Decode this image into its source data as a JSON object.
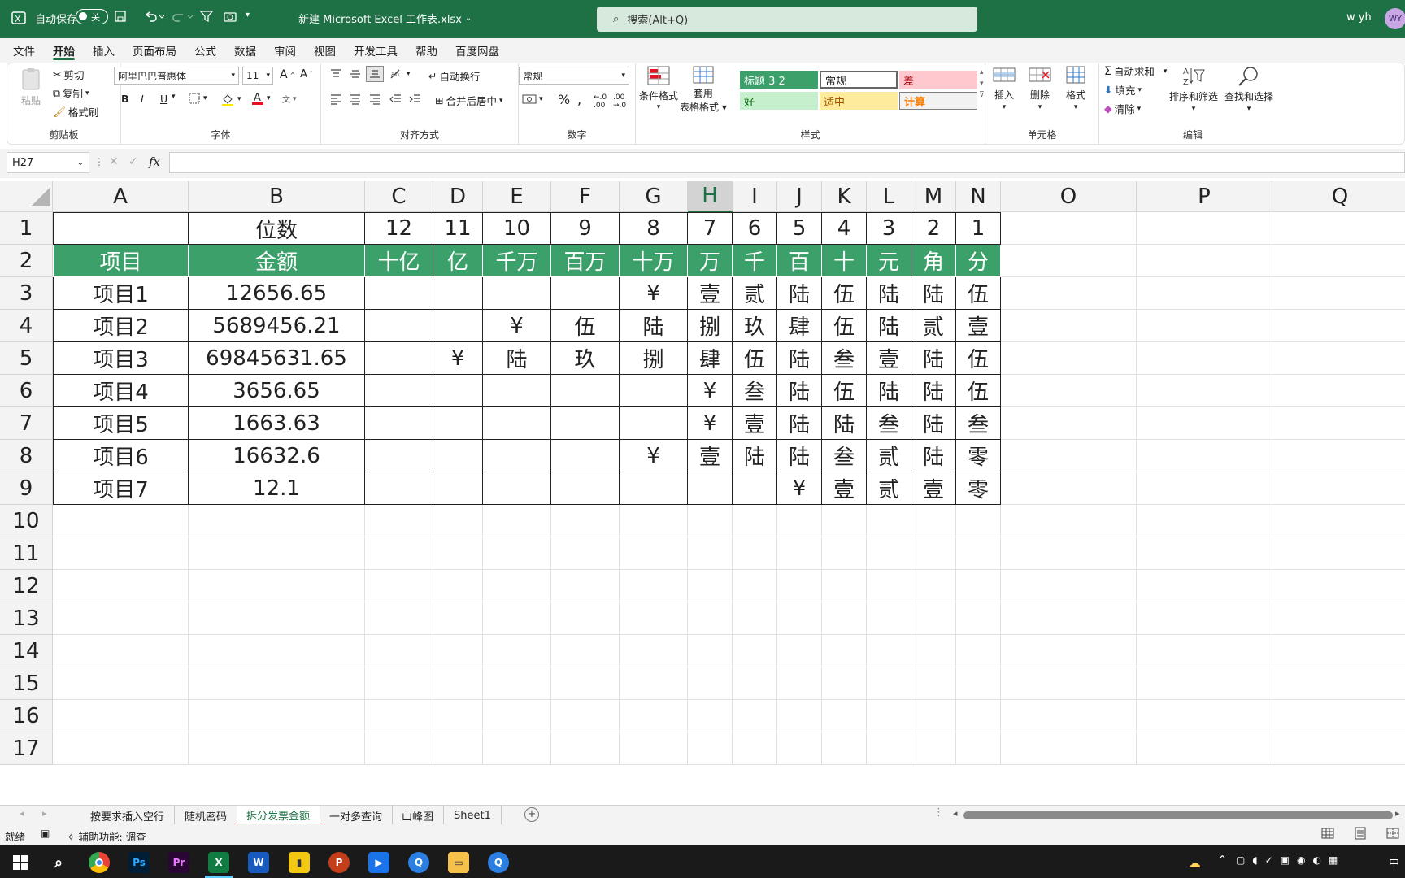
{
  "title_bar": {
    "autosave_label": "自动保存",
    "autosave_state": "关",
    "file_name": "新建 Microsoft Excel 工作表.xlsx",
    "search_placeholder": "搜索(Alt+Q)",
    "user_name": "w yh",
    "user_initials": "WY",
    "accent_color": "#1e7145"
  },
  "menu": [
    "文件",
    "开始",
    "插入",
    "页面布局",
    "公式",
    "数据",
    "审阅",
    "视图",
    "开发工具",
    "帮助",
    "百度网盘"
  ],
  "active_menu": "开始",
  "ribbon": {
    "clipboard": {
      "paste": "粘贴",
      "cut": "剪切",
      "copy": "复制",
      "format_painter": "格式刷",
      "label": "剪贴板"
    },
    "font": {
      "font_name": "阿里巴巴普惠体",
      "font_size": "11",
      "bold": "B",
      "italic": "I",
      "underline": "U",
      "label": "字体"
    },
    "alignment": {
      "wrap": "自动换行",
      "merge": "合并后居中",
      "label": "对齐方式"
    },
    "number": {
      "format": "常规",
      "label": "数字"
    },
    "styles": {
      "conditional": "条件格式",
      "table_format_1": "套用",
      "table_format_2": "表格格式",
      "label": "样式",
      "cells": [
        "标题 3 2",
        "常规",
        "差",
        "好",
        "适中",
        "计算"
      ]
    },
    "cells": {
      "insert": "插入",
      "delete": "删除",
      "format": "格式",
      "label": "单元格"
    },
    "editing": {
      "autosum": "自动求和",
      "fill": "填充",
      "clear": "清除",
      "sort": "排序和筛选",
      "find": "查找和选择",
      "label": "编辑"
    }
  },
  "formula_bar": {
    "name_box": "H27",
    "fx": "fx",
    "formula": ""
  },
  "sheet": {
    "columns": [
      "A",
      "B",
      "C",
      "D",
      "E",
      "F",
      "G",
      "H",
      "I",
      "J",
      "K",
      "L",
      "M",
      "N",
      "O",
      "P",
      "Q"
    ],
    "selected_column": "H",
    "row_numbers": [
      "1",
      "2",
      "3",
      "4",
      "5",
      "6",
      "7",
      "8",
      "9",
      "10",
      "11",
      "12",
      "13",
      "14",
      "15",
      "16",
      "17"
    ],
    "rows": [
      [
        "",
        "位数",
        "12",
        "11",
        "10",
        "9",
        "8",
        "7",
        "6",
        "5",
        "4",
        "3",
        "2",
        "1"
      ],
      [
        "项目",
        "金额",
        "十亿",
        "亿",
        "千万",
        "百万",
        "十万",
        "万",
        "千",
        "百",
        "十",
        "元",
        "角",
        "分"
      ],
      [
        "项目1",
        "12656.65",
        "",
        "",
        "",
        "",
        "¥",
        "壹",
        "贰",
        "陆",
        "伍",
        "陆",
        "陆",
        "伍"
      ],
      [
        "项目2",
        "5689456.21",
        "",
        "",
        "¥",
        "伍",
        "陆",
        "捌",
        "玖",
        "肆",
        "伍",
        "陆",
        "贰",
        "壹"
      ],
      [
        "项目3",
        "69845631.65",
        "",
        "¥",
        "陆",
        "玖",
        "捌",
        "肆",
        "伍",
        "陆",
        "叁",
        "壹",
        "陆",
        "伍"
      ],
      [
        "项目4",
        "3656.65",
        "",
        "",
        "",
        "",
        "",
        "¥",
        "叁",
        "陆",
        "伍",
        "陆",
        "陆",
        "伍"
      ],
      [
        "项目5",
        "1663.63",
        "",
        "",
        "",
        "",
        "",
        "¥",
        "壹",
        "陆",
        "陆",
        "叁",
        "陆",
        "叁"
      ],
      [
        "项目6",
        "16632.6",
        "",
        "",
        "",
        "",
        "¥",
        "壹",
        "陆",
        "陆",
        "叁",
        "贰",
        "陆",
        "零"
      ],
      [
        "项目7",
        "12.1",
        "",
        "",
        "",
        "",
        "",
        "",
        "",
        "¥",
        "壹",
        "贰",
        "壹",
        "零"
      ]
    ],
    "header_fill_color": "#3ca06a"
  },
  "sheet_tabs": [
    "按要求插入空行",
    "随机密码",
    "拆分发票金额",
    "一对多查询",
    "山峰图",
    "Sheet1"
  ],
  "active_sheet": "拆分发票金额",
  "status": {
    "ready": "就绪",
    "accessibility": "辅助功能: 调查"
  },
  "taskbar": {
    "ime": "中"
  }
}
